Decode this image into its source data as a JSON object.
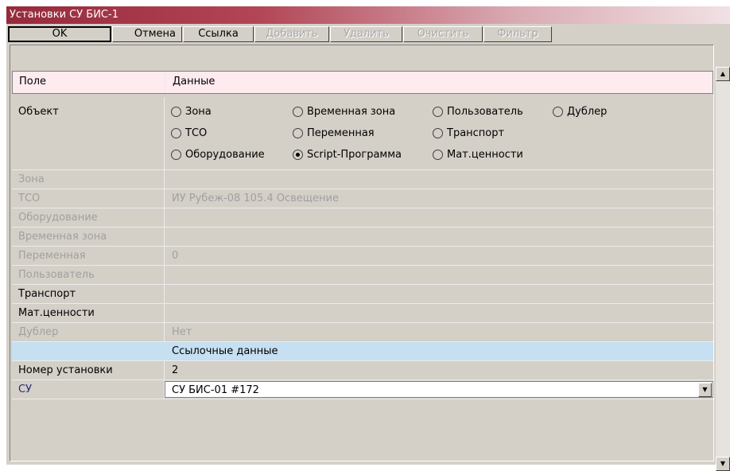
{
  "window": {
    "title": "Установки СУ БИС-1"
  },
  "toolbar": {
    "ok": "OK",
    "cancel": "Отмена",
    "link": "Ссылка",
    "add": "Добавить",
    "delete": "Удалить",
    "clear": "Очистить",
    "filter": "Фильтр"
  },
  "header": {
    "field": "Поле",
    "data": "Данные"
  },
  "object": {
    "label": "Объект",
    "options": [
      "Зона",
      "Временная зона",
      "Пользователь",
      "Дублер",
      "ТСО",
      "Переменная",
      "Транспорт",
      "Оборудование",
      "Script-Программа",
      "Мат.ценности"
    ],
    "selected": "Script-Программа"
  },
  "rows": [
    {
      "label": "Зона",
      "value": ""
    },
    {
      "label": "ТСО",
      "value": "ИУ Рубеж-08  105.4 Освещение"
    },
    {
      "label": "Оборудование",
      "value": ""
    },
    {
      "label": "Временная зона",
      "value": ""
    },
    {
      "label": "Переменная",
      "value": "0"
    },
    {
      "label": "Пользователь",
      "value": ""
    },
    {
      "label": "Транспорт",
      "value": ""
    },
    {
      "label": "Мат.ценности",
      "value": ""
    },
    {
      "label": "Дублер",
      "value": "Нет"
    }
  ],
  "reference": {
    "title": "Ссылочные данные"
  },
  "install_number": {
    "label": "Номер установки",
    "value": "2"
  },
  "su": {
    "label": "СУ",
    "value": "СУ БИС-01 #172"
  },
  "colors": {
    "title_bar": "#962a3c",
    "header_row": "#fdebef",
    "reference_row": "#c6dff1",
    "face": "#d4d0c8"
  }
}
